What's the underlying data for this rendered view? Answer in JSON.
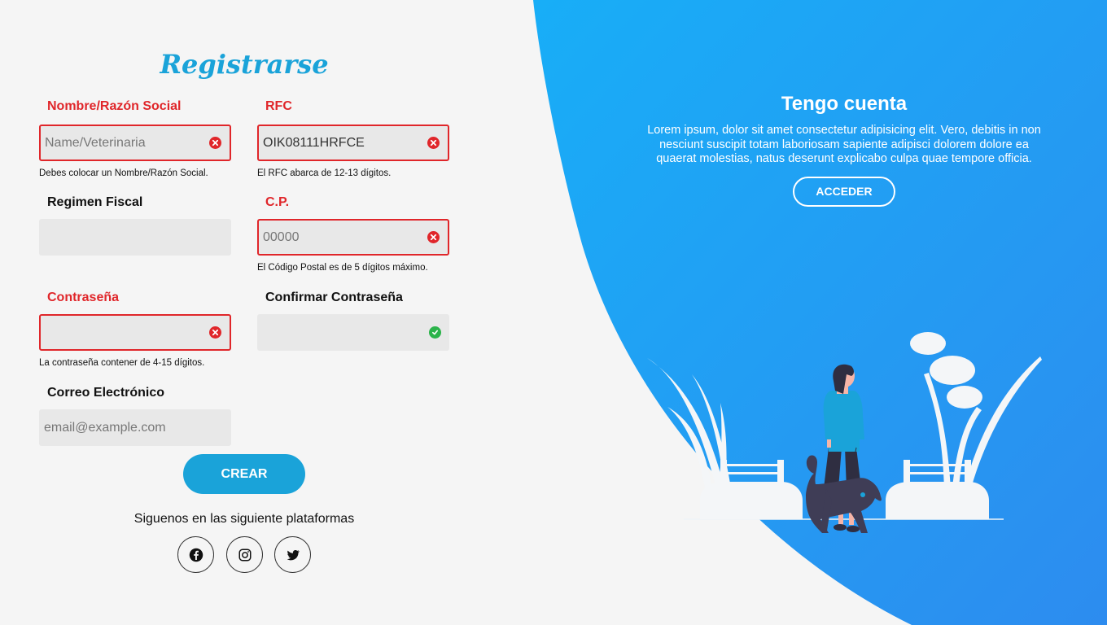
{
  "form": {
    "title": "Registrarse",
    "fields": {
      "nombre": {
        "label": "Nombre/Razón Social",
        "placeholder": "Name/Veterinaria",
        "value": "",
        "help": "Debes colocar un Nombre/Razón Social.",
        "status": "error"
      },
      "rfc": {
        "label": "RFC",
        "placeholder": "",
        "value": "OIK08111HRFCE",
        "help": "El RFC abarca de 12-13 dígitos.",
        "status": "error"
      },
      "regimen": {
        "label": "Regimen Fiscal",
        "placeholder": "",
        "value": "",
        "status": "none"
      },
      "cp": {
        "label": "C.P.",
        "placeholder": "00000",
        "value": "",
        "help": "El Código Postal es de 5 dígitos máximo.",
        "status": "error"
      },
      "password": {
        "label": "Contraseña",
        "placeholder": "",
        "value": "",
        "help": "La contraseña contener de 4-15 dígitos.",
        "status": "error"
      },
      "confirm": {
        "label": "Confirmar Contraseña",
        "placeholder": "",
        "value": "",
        "status": "ok"
      },
      "email": {
        "label": "Correo Electrónico",
        "placeholder": "email@example.com",
        "value": "",
        "status": "none"
      }
    },
    "submit_label": "CREAR",
    "social_text": "Siguenos en las siguiente plataformas",
    "social_icons": [
      "facebook-icon",
      "instagram-icon",
      "twitter-icon"
    ]
  },
  "panel": {
    "title": "Tengo cuenta",
    "text": "Lorem ipsum, dolor sit amet consectetur adipisicing elit. Vero, debitis in non nesciunt suscipit totam laboriosam sapiente adipisci dolorem dolore ea quaerat molestias, natus deserunt explicabo culpa quae tempore officia.",
    "button_label": "ACCEDER"
  },
  "colors": {
    "accent": "#1aa3d9",
    "error": "#e0262a",
    "success": "#2bb34a",
    "panel_start": "#1aa7f5",
    "panel_end": "#2b8ff0"
  }
}
